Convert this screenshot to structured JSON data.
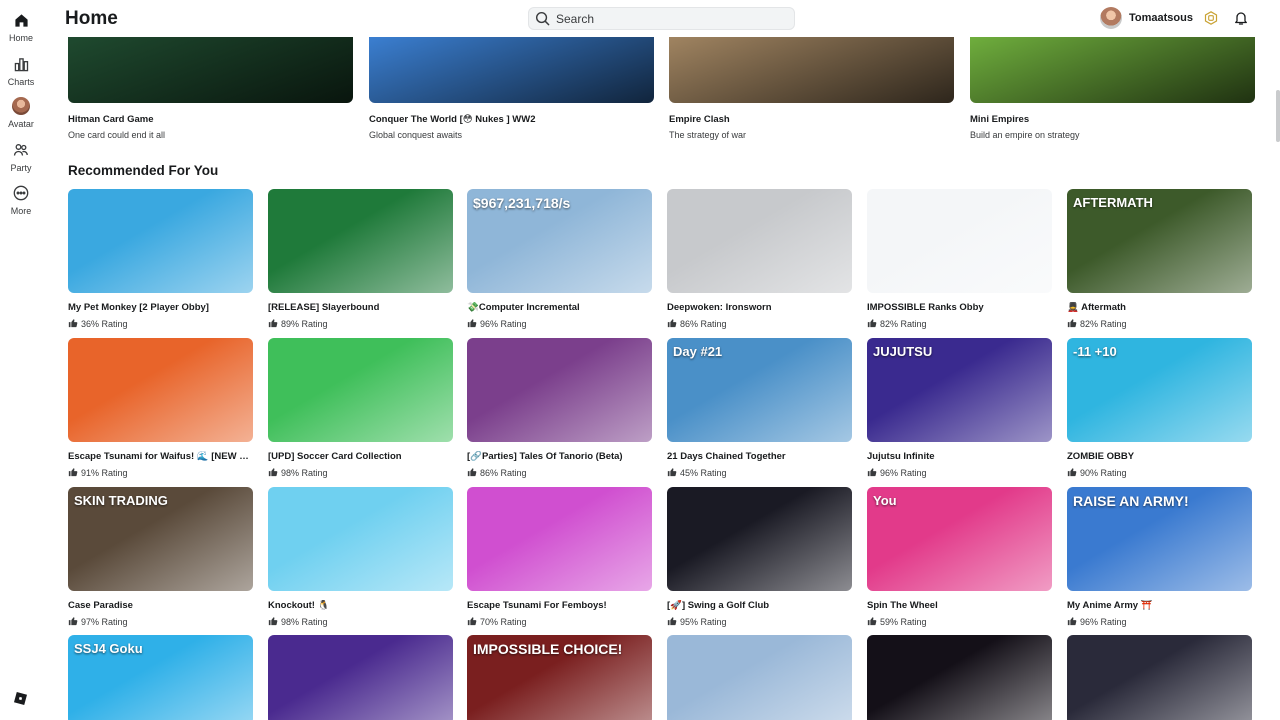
{
  "sidebar": {
    "items": [
      {
        "label": "Home",
        "icon": "home-icon"
      },
      {
        "label": "Charts",
        "icon": "charts-icon"
      },
      {
        "label": "Avatar",
        "icon": "avatar-icon"
      },
      {
        "label": "Party",
        "icon": "party-icon"
      },
      {
        "label": "More",
        "icon": "more-icon"
      }
    ]
  },
  "header": {
    "title": "Home",
    "search_placeholder": "Search",
    "username": "Tomaatsous"
  },
  "top_row": [
    {
      "title": "Hitman Card Game",
      "subtitle": "One card could end it all",
      "color": "#1f4a2f"
    },
    {
      "title": "Conquer The World [😳 Nukes ] WW2",
      "subtitle": "Global conquest awaits",
      "color": "#3b7fd1"
    },
    {
      "title": "Empire Clash",
      "subtitle": "The strategy of war",
      "color": "#a08461"
    },
    {
      "title": "Mini Empires",
      "subtitle": "Build an empire on strategy",
      "color": "#6fae3d"
    }
  ],
  "section": {
    "title": "Recommended For You"
  },
  "games": [
    {
      "title": "My Pet Monkey [2 Player Obby]",
      "rating": "36% Rating",
      "color": "#3aa8e0"
    },
    {
      "title": "[RELEASE] Slayerbound",
      "rating": "89% Rating",
      "color": "#1f7a3a"
    },
    {
      "title": "💸Computer Incremental",
      "rating": "96% Rating",
      "color": "#8fb6d8",
      "overlay": "$967,231,718/s"
    },
    {
      "title": "Deepwoken: Ironsworn",
      "rating": "86% Rating",
      "color": "#c7c9cc"
    },
    {
      "title": "IMPOSSIBLE Ranks Obby",
      "rating": "82% Rating",
      "color": "#f4f6f8"
    },
    {
      "title": "💂 Aftermath",
      "rating": "82% Rating",
      "color": "#3d5a2a",
      "overlay": "AFTERMATH"
    },
    {
      "title": "Escape Tsunami for Waifus! 🌊 [NEW R...",
      "rating": "91% Rating",
      "color": "#e8642a"
    },
    {
      "title": "[UPD] Soccer Card Collection",
      "rating": "98% Rating",
      "color": "#3fbf5a"
    },
    {
      "title": "[🔗Parties] Tales Of Tanorio (Beta)",
      "rating": "86% Rating",
      "color": "#7b3f8c"
    },
    {
      "title": "21 Days Chained Together",
      "rating": "45% Rating",
      "color": "#4a90c8",
      "overlay": "Day #21"
    },
    {
      "title": "Jujutsu Infinite",
      "rating": "96% Rating",
      "color": "#3a2a8f",
      "overlay": "JUJUTSU"
    },
    {
      "title": "ZOMBIE OBBY",
      "rating": "90% Rating",
      "color": "#2fb5e0",
      "overlay": "-11  +10"
    },
    {
      "title": "Case Paradise",
      "rating": "97% Rating",
      "color": "#5a4a3a",
      "overlay": "SKIN TRADING"
    },
    {
      "title": "Knockout! 🐧",
      "rating": "98% Rating",
      "color": "#6fd0f0"
    },
    {
      "title": "Escape Tsunami For Femboys!",
      "rating": "70% Rating",
      "color": "#d04fd0"
    },
    {
      "title": "[🚀] Swing a Golf Club",
      "rating": "95% Rating",
      "color": "#1a1a24"
    },
    {
      "title": "Spin The Wheel",
      "rating": "59% Rating",
      "color": "#e23a8a",
      "overlay": "You"
    },
    {
      "title": "My Anime Army ⛩️",
      "rating": "96% Rating",
      "color": "#3a7ad0",
      "overlay": "RAISE AN ARMY!"
    },
    {
      "title": "",
      "rating": "",
      "color": "#2fb0e8",
      "overlay": "SSJ4 Goku"
    },
    {
      "title": "",
      "rating": "",
      "color": "#4a2a8f"
    },
    {
      "title": "",
      "rating": "",
      "color": "#7a1f1f",
      "overlay": "IMPOSSIBLE CHOICE!"
    },
    {
      "title": "",
      "rating": "",
      "color": "#9ab8d8"
    },
    {
      "title": "",
      "rating": "",
      "color": "#141018"
    },
    {
      "title": "",
      "rating": "",
      "color": "#2a2a3a"
    }
  ]
}
